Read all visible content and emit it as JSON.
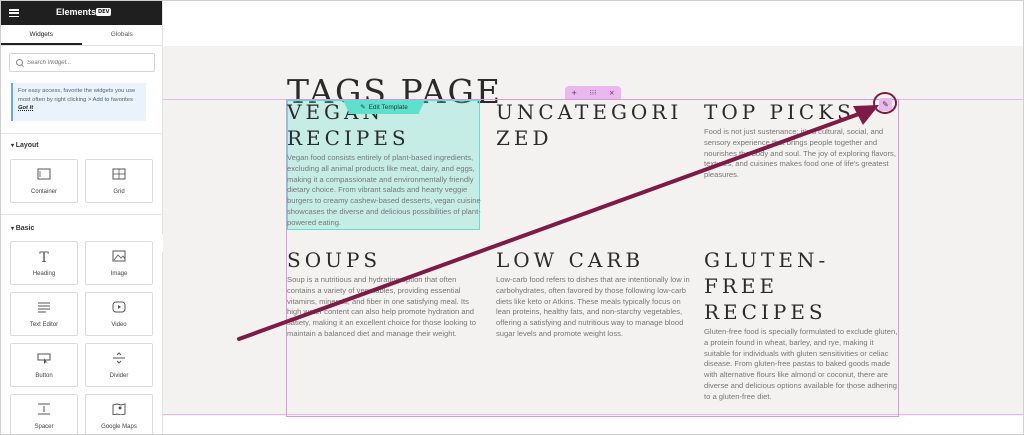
{
  "sidebar": {
    "title": "Elements",
    "badge": "DEV",
    "tabs": [
      "Widgets",
      "Globals"
    ],
    "search_placeholder": "Search Widget...",
    "tip_text": "For easy access, favorite the widgets you use most often by right clicking > Add to favorites",
    "tip_link": "Got It",
    "sections": [
      {
        "label": "Layout",
        "widgets": [
          {
            "label": "Container",
            "icon": "container-icon"
          },
          {
            "label": "Grid",
            "icon": "grid-icon"
          }
        ]
      },
      {
        "label": "Basic",
        "widgets": [
          {
            "label": "Heading",
            "icon": "heading-icon"
          },
          {
            "label": "Image",
            "icon": "image-icon"
          },
          {
            "label": "Text Editor",
            "icon": "text-editor-icon"
          },
          {
            "label": "Video",
            "icon": "video-icon"
          },
          {
            "label": "Button",
            "icon": "button-icon"
          },
          {
            "label": "Divider",
            "icon": "divider-icon"
          },
          {
            "label": "Spacer",
            "icon": "spacer-icon"
          },
          {
            "label": "Google Maps",
            "icon": "map-icon"
          }
        ]
      }
    ]
  },
  "canvas": {
    "page_title": "TAGS PAGE",
    "edit_template_label": "Edit Template",
    "tags": [
      {
        "title": "VEGAN RECIPES",
        "body": "Vegan food consists entirely of plant-based ingredients, excluding all animal products like meat, dairy, and eggs, making it a compassionate and environmentally friendly dietary choice. From vibrant salads and hearty veggie burgers to creamy cashew-based desserts, vegan cuisine showcases the diverse and delicious possibilities of plant-powered eating."
      },
      {
        "title": "UNCATEGORIZED",
        "body": ""
      },
      {
        "title": "TOP PICKS",
        "body": "Food is not just sustenance; it's a cultural, social, and sensory experience that brings people together and nourishes the body and soul. The joy of exploring flavors, textures, and cuisines makes food one of life's greatest pleasures."
      },
      {
        "title": "SOUPS",
        "body": "Soup is a nutritious and hydrating option that often contains a variety of vegetables, providing essential vitamins, minerals, and fiber in one satisfying meal. Its high water content can also help promote hydration and satiety, making it an excellent choice for those looking to maintain a balanced diet and manage their weight."
      },
      {
        "title": "LOW CARB",
        "body": "Low-carb food refers to dishes that are intentionally low in carbohydrates, often favored by those following low-carb diets like keto or Atkins. These meals typically focus on lean proteins, healthy fats, and non-starchy vegetables, offering a satisfying and nutritious way to manage blood sugar levels and promote weight loss."
      },
      {
        "title": "GLUTEN-FREE RECIPES",
        "body": "Gluten-free food is specially formulated to exclude gluten, a protein found in wheat, barley, and rye, making it suitable for individuals with gluten sensitivities or celiac disease. From gluten-free pastas to baked goods made with alternative flours like almond or coconut, there are diverse and delicious options available for those adhering to a gluten-free diet."
      }
    ]
  },
  "colors": {
    "accent_pink": "#e9b8ec",
    "accent_teal": "#5ee0cc",
    "annotation": "#7e1a45"
  }
}
